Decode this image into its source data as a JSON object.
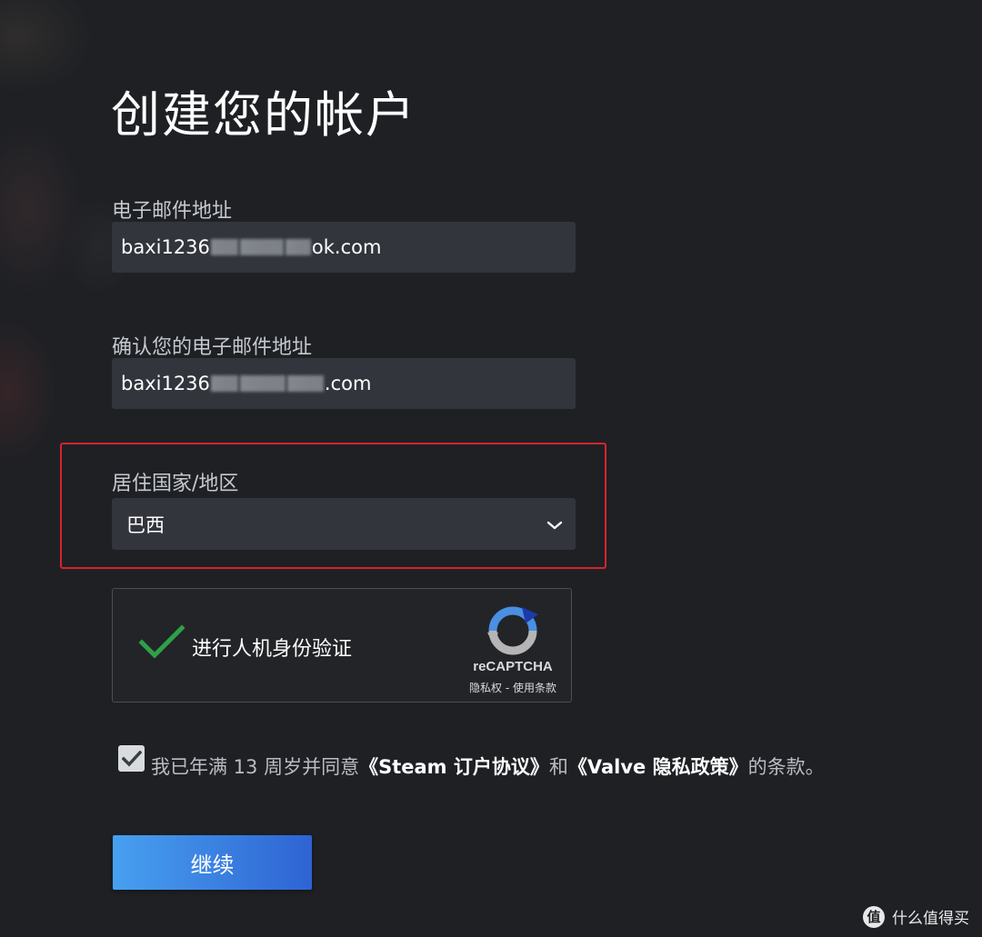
{
  "page": {
    "title": "创建您的帐户"
  },
  "email": {
    "label": "电子邮件地址",
    "value_start": "baxi1236",
    "value_end": "ok.com"
  },
  "confirm_email": {
    "label": "确认您的电子邮件地址",
    "value_start": "baxi1236",
    "value_end": ".com"
  },
  "country": {
    "label": "居住国家/地区",
    "selected": "巴西",
    "icon": "chevron-down-icon"
  },
  "recaptcha": {
    "label": "进行人机身份验证",
    "brand": "reCAPTCHA",
    "terms": "隐私权 - 使用条款",
    "checked": true,
    "colors": {
      "check": "#2fa04a",
      "logo_blue": "#4a90e2",
      "logo_dark_blue": "#1c3aa9",
      "logo_gray": "#b5b5b5"
    }
  },
  "agreement": {
    "checked": true,
    "prefix": "我已年满 13 周岁并同意",
    "link1": "《Steam 订户协议》",
    "middle": "和",
    "link2": "《Valve 隐私政策》",
    "suffix": "的条款。"
  },
  "actions": {
    "continue_label": "继续",
    "button_color": "#3a7fe0"
  },
  "highlight": {
    "color": "#d8232a"
  },
  "watermark": {
    "logo_text": "值",
    "text": "什么值得买"
  }
}
